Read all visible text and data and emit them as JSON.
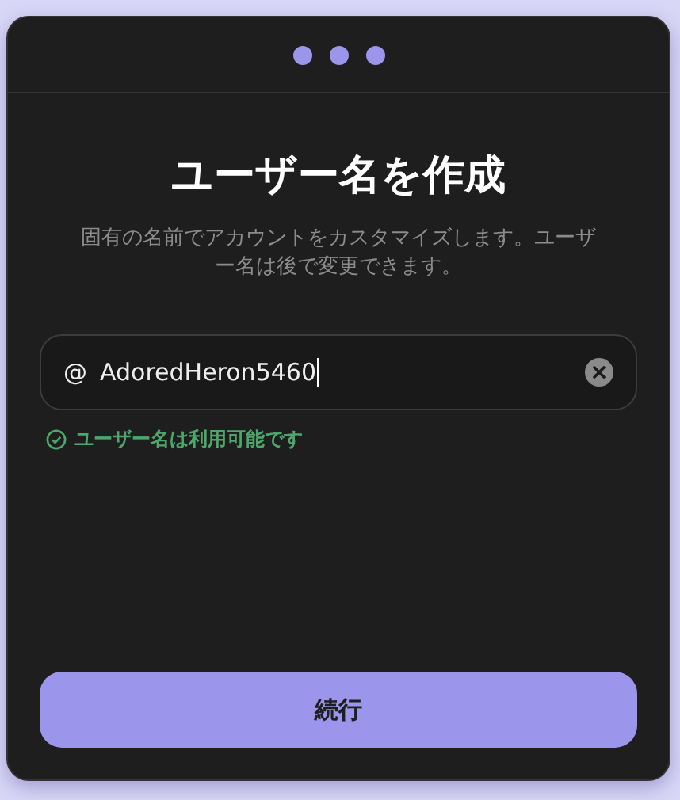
{
  "title": "ユーザー名を作成",
  "description": "固有の名前でアカウントをカスタマイズします。ユーザー名は後で変更できます。",
  "username_field": {
    "prefix": "@",
    "value": "AdoredHeron5460"
  },
  "status": {
    "text": "ユーザー名は利用可能です",
    "available": true
  },
  "continue_button": "続行"
}
